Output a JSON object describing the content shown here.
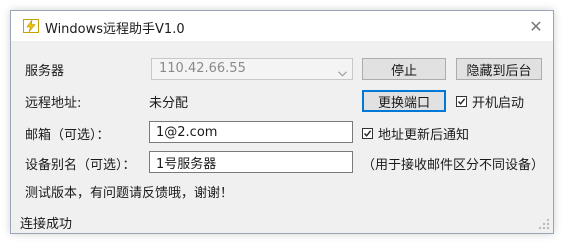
{
  "window": {
    "title": "Windows远程助手V1.0",
    "close_symbol": "✕"
  },
  "form": {
    "server_label": "服务器",
    "server_value": "110.42.66.55",
    "remote_label": "远程地址:",
    "remote_value": "未分配",
    "email_label": "邮箱（可选）：",
    "email_value": "1@2.com",
    "alias_label": "设备别名（可选）：",
    "alias_value": "1号服务器",
    "alias_hint": "（用于接收邮件区分不同设备）",
    "notice": "测试版本，有问题请反馈哦，谢谢！"
  },
  "buttons": {
    "stop": "停止",
    "hide_tray": "隐藏到后台",
    "change_port": "更换端口"
  },
  "checkboxes": {
    "autostart": {
      "label": "开机启动",
      "checked": true
    },
    "notify": {
      "label": "地址更新后通知",
      "checked": true
    }
  },
  "status": {
    "text": "连接成功"
  },
  "icons": {
    "app": "app-lightning-icon",
    "combo_arrow": "chevron-down-icon",
    "check": "checkmark-icon",
    "grip": "resize-grip-icon"
  },
  "colors": {
    "focus_border": "#0078d7",
    "button_face": "#e1e1e1",
    "window_bg": "#f0f0f0"
  }
}
